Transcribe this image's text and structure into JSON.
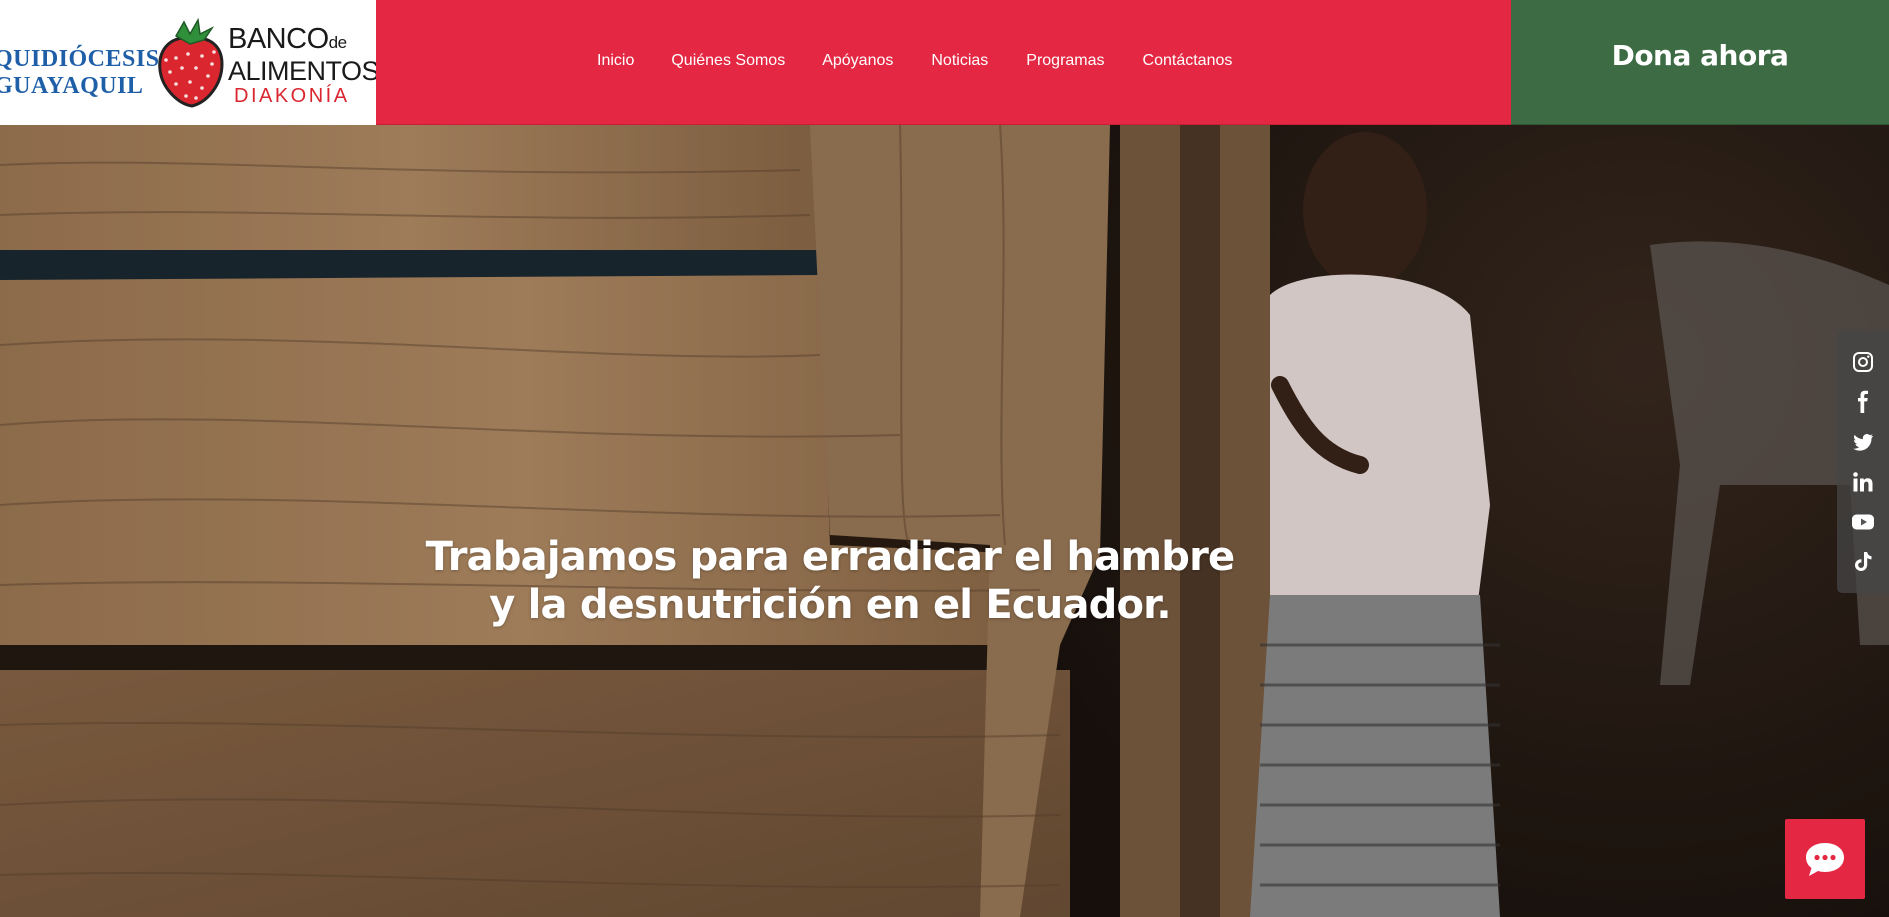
{
  "logos": {
    "archdiocese_line1": "QUIDIÓCESIS",
    "archdiocese_line2": "GUAYAQUIL",
    "banco_line1": "BANCO",
    "banco_de": "de",
    "banco_line2": "ALIMENTOS",
    "banco_line3": "DIAKONÍA"
  },
  "nav": {
    "items": [
      {
        "label": "Inicio"
      },
      {
        "label": "Quiénes Somos"
      },
      {
        "label": "Apóyanos"
      },
      {
        "label": "Noticias"
      },
      {
        "label": "Programas"
      },
      {
        "label": "Contáctanos"
      }
    ]
  },
  "donate": {
    "label": "Dona ahora"
  },
  "hero": {
    "line1": "Trabajamos para erradicar el hambre",
    "line2": "y la desnutrición en el Ecuador."
  },
  "social": {
    "icons": [
      "instagram-icon",
      "facebook-icon",
      "twitter-icon",
      "linkedin-icon",
      "youtube-icon",
      "tiktok-icon"
    ]
  },
  "chat": {
    "icon": "chat-bubble-icon"
  },
  "colors": {
    "nav_red": "#e42844",
    "donate_green": "#3d6b44",
    "brand_blue": "#1f5fa8",
    "strawberry_red": "#d9262f"
  }
}
